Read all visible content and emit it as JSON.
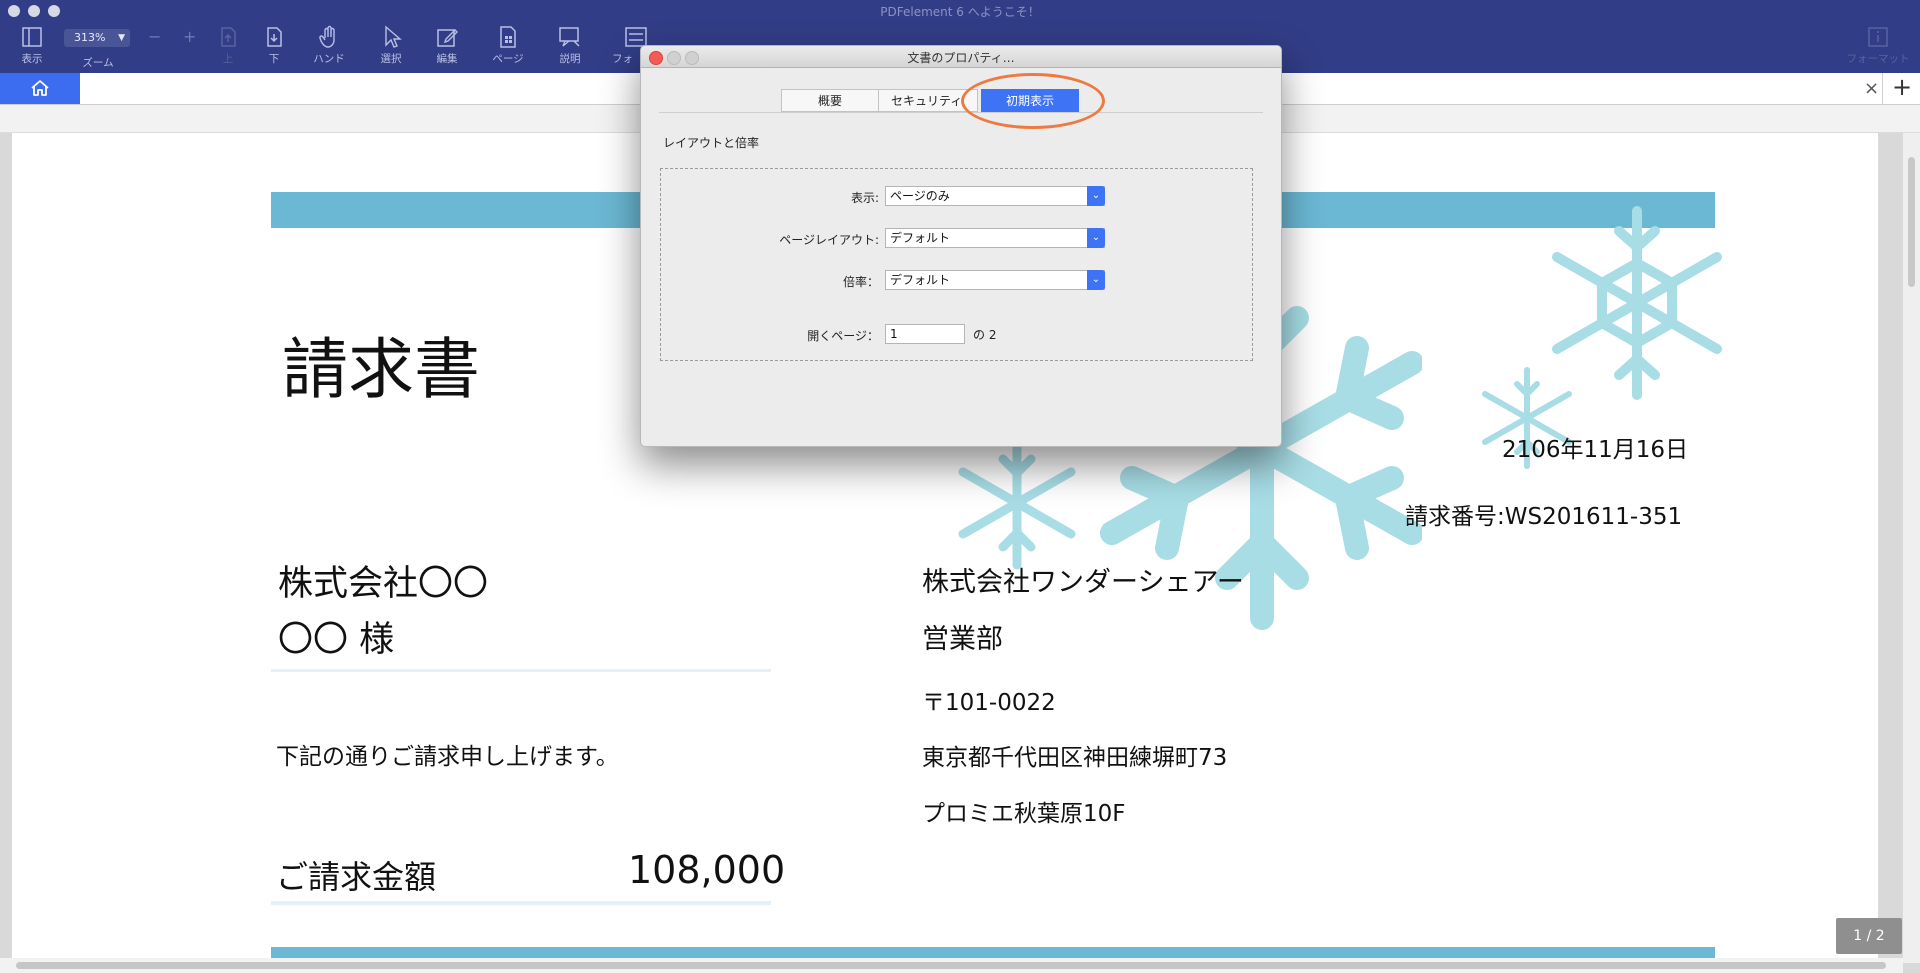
{
  "app": {
    "title": "PDFelement 6 へようこそ！"
  },
  "toolbar": {
    "view_label": "表示",
    "zoom_label": "ズーム",
    "zoom_value": "313%",
    "zoom_out": "−",
    "zoom_in": "+",
    "up_label": "上",
    "down_label": "下",
    "hand_label": "ハンド",
    "select_label": "選択",
    "edit_label": "編集",
    "page_label": "ページ",
    "comment_label": "説明",
    "form_label": "フォ",
    "format_label": "フォーマット"
  },
  "tabs": {
    "close": "×",
    "add": "+"
  },
  "dialog": {
    "title": "文書のプロパティ…",
    "tabs": [
      "概要",
      "セキュリティ",
      "初期表示"
    ],
    "active_tab": "初期表示",
    "section_title": "レイアウトと倍率",
    "fields": {
      "display_label": "表示:",
      "display_value": "ページのみ",
      "layout_label": "ページレイアウト:",
      "layout_value": "デフォルト",
      "zoom_label": "倍率：",
      "zoom_value": "デフォルト",
      "open_page_label": "開くページ：",
      "open_page_value": "1",
      "page_total": "の 2"
    },
    "highlight_color": "#ec7a42",
    "accent_color": "#3f73f5"
  },
  "document": {
    "title": "請求書",
    "date": "2106年11月16日",
    "invoice_number": "請求番号:WS201611-351",
    "client_company": "株式会社〇〇",
    "client_name": "〇〇 様",
    "message": "下記の通りご請求申し上げます。",
    "amount_label": "ご請求金額",
    "amount_value": "108,000",
    "sender_company": "株式会社ワンダーシェアー",
    "sender_dept": "営業部",
    "postal": "〒101-0022",
    "address1": "東京都千代田区神田練塀町73",
    "address2": "プロミエ秋葉原10F",
    "accent_color": "#6bb8d4"
  },
  "status": {
    "page_indicator": "1 / 2"
  }
}
